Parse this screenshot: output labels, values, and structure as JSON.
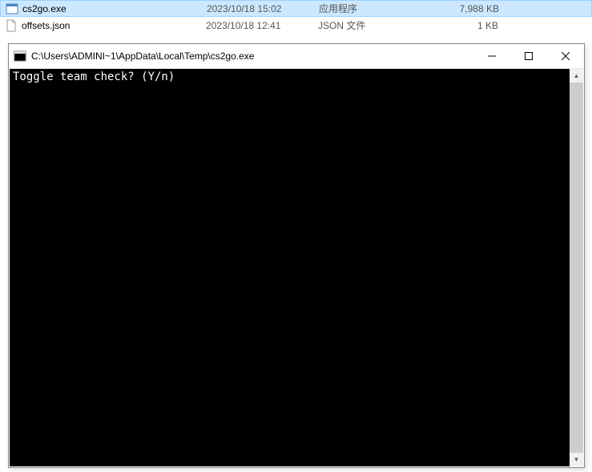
{
  "file_list": {
    "rows": [
      {
        "name": "cs2go.exe",
        "date": "2023/10/18 15:02",
        "type": "应用程序",
        "size": "7,988 KB",
        "selected": true,
        "icon": "exe"
      },
      {
        "name": "offsets.json",
        "date": "2023/10/18 12:41",
        "type": "JSON 文件",
        "size": "1 KB",
        "selected": false,
        "icon": "file"
      }
    ]
  },
  "console": {
    "title": "C:\\Users\\ADMINI~1\\AppData\\Local\\Temp\\cs2go.exe",
    "output": "Toggle team check? (Y/n)"
  }
}
